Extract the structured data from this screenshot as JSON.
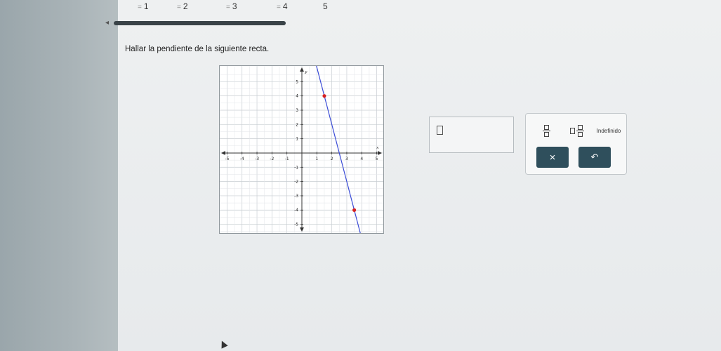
{
  "tabs": [
    {
      "prefix": "=",
      "label": "1"
    },
    {
      "prefix": "=",
      "label": "2"
    },
    {
      "prefix": "=",
      "label": "3"
    },
    {
      "prefix": "=",
      "label": "4"
    },
    {
      "prefix": "",
      "label": "5"
    }
  ],
  "progress": {
    "arrow": "◂",
    "fraction": 1.0
  },
  "question": {
    "text": "Hallar la pendiente de la siguiente recta."
  },
  "graph": {
    "x_ticks": [
      "-5",
      "-4",
      "-3",
      "-2",
      "-1",
      "1",
      "2",
      "3",
      "4",
      "5"
    ],
    "y_ticks": [
      "5",
      "4",
      "3",
      "2",
      "1",
      "-1",
      "-2",
      "-3",
      "-4",
      "-5"
    ],
    "x_label": "x",
    "y_label": "y",
    "points": [
      {
        "x": 1.5,
        "y": 4
      },
      {
        "x": 3.5,
        "y": -4
      }
    ],
    "line_color": "#3a4bd6",
    "point_color": "#d62020"
  },
  "keypad": {
    "undefined_label": "Indefinido",
    "clear_symbol": "×",
    "undo_symbol": "↶"
  }
}
